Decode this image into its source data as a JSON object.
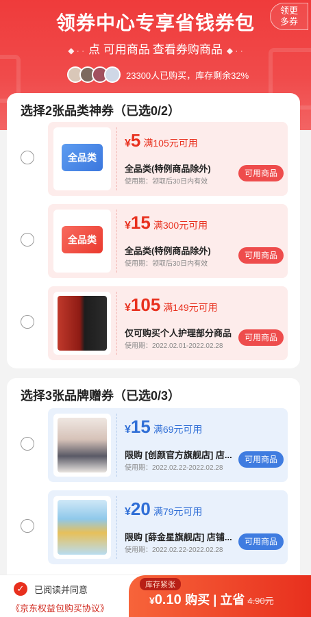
{
  "header": {
    "title": "领券中心专享省钱券包",
    "more_button": "领更多券",
    "subtitle_left": "点 可用商品",
    "subtitle_right": "查看券购商品",
    "dots": "◆ · ·",
    "buyers_text": "23300人已购买，库存剩余32%"
  },
  "category_section": {
    "title": "选择2张品类神券（已选0/2）",
    "coupons": [
      {
        "currency": "¥",
        "amount": "5",
        "condition": "满105元可用",
        "desc": "全品类(特例商品除外)",
        "validity": "使用期：领取后30日内有效",
        "button": "可用商品",
        "image_label": "全品类"
      },
      {
        "currency": "¥",
        "amount": "15",
        "condition": "满300元可用",
        "desc": "全品类(特例商品除外)",
        "validity": "使用期：领取后30日内有效",
        "button": "可用商品",
        "image_label": "全品类"
      },
      {
        "currency": "¥",
        "amount": "105",
        "condition": "满149元可用",
        "desc": "仅可购买个人护理部分商品",
        "validity": "使用期：2022.02.01-2022.02.28",
        "button": "可用商品"
      }
    ]
  },
  "brand_section": {
    "title": "选择3张品牌赠券（已选0/3）",
    "coupons": [
      {
        "currency": "¥",
        "amount": "15",
        "condition": "满69元可用",
        "desc": "限购 [创颜官方旗舰店] 店...",
        "validity": "使用期：2022.02.22-2022.02.28",
        "button": "可用商品"
      },
      {
        "currency": "¥",
        "amount": "20",
        "condition": "满79元可用",
        "desc": "限购 [薛金星旗舰店] 店铺...",
        "validity": "使用期：2022.02.22-2022.02.28",
        "button": "可用商品"
      }
    ]
  },
  "bottom_bar": {
    "agree_text": "已阅读并同意",
    "agreement_link": "《京东权益包购买协议》",
    "stock_tag": "库存紧张",
    "currency": "¥",
    "price": "0.10",
    "buy_label": "购买 | 立省",
    "original": "4.90元"
  },
  "colors": {
    "brand_red": "#e8301e",
    "coupon_blue": "#2f6ed6",
    "hero_red": "#ef3b3b"
  }
}
